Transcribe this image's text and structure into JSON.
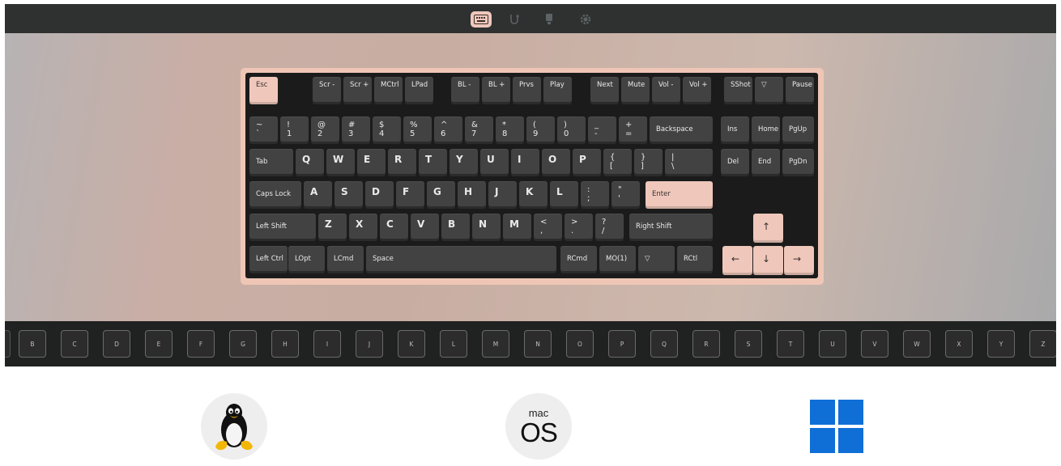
{
  "toolbar": {
    "icons": [
      "keyboard-icon",
      "macro-icon",
      "lighting-icon",
      "settings-icon"
    ],
    "active": "keyboard-icon"
  },
  "keyboard": {
    "row_f": [
      {
        "label": "Esc"
      },
      {
        "label": "Scr -"
      },
      {
        "label": "Scr +"
      },
      {
        "label": "MCtrl"
      },
      {
        "label": "LPad"
      },
      {
        "label": "BL -"
      },
      {
        "label": "BL +"
      },
      {
        "label": "Prvs"
      },
      {
        "label": "Play"
      },
      {
        "label": "Next"
      },
      {
        "label": "Mute"
      },
      {
        "label": "Vol -"
      },
      {
        "label": "Vol +"
      },
      {
        "label": "SShot"
      },
      {
        "label": "▽"
      },
      {
        "label": "Pause"
      }
    ],
    "row_num": [
      {
        "top": "~",
        "bot": "`"
      },
      {
        "top": "!",
        "bot": "1"
      },
      {
        "top": "@",
        "bot": "2"
      },
      {
        "top": "#",
        "bot": "3"
      },
      {
        "top": "$",
        "bot": "4"
      },
      {
        "top": "%",
        "bot": "5"
      },
      {
        "top": "^",
        "bot": "6"
      },
      {
        "top": "&",
        "bot": "7"
      },
      {
        "top": "*",
        "bot": "8"
      },
      {
        "top": "(",
        "bot": "9"
      },
      {
        "top": ")",
        "bot": "0"
      },
      {
        "top": "_",
        "bot": "-"
      },
      {
        "top": "+",
        "bot": "="
      },
      {
        "label": "Backspace"
      },
      {
        "label": "Ins"
      },
      {
        "label": "Home"
      },
      {
        "label": "PgUp"
      }
    ],
    "row_q": [
      {
        "label": "Tab"
      },
      {
        "label": "Q"
      },
      {
        "label": "W"
      },
      {
        "label": "E"
      },
      {
        "label": "R"
      },
      {
        "label": "T"
      },
      {
        "label": "Y"
      },
      {
        "label": "U"
      },
      {
        "label": "I"
      },
      {
        "label": "O"
      },
      {
        "label": "P"
      },
      {
        "top": "{",
        "bot": "["
      },
      {
        "top": "}",
        "bot": "]"
      },
      {
        "top": "|",
        "bot": "\\"
      },
      {
        "label": "Del"
      },
      {
        "label": "End"
      },
      {
        "label": "PgDn"
      }
    ],
    "row_a": [
      {
        "label": "Caps Lock"
      },
      {
        "label": "A"
      },
      {
        "label": "S"
      },
      {
        "label": "D"
      },
      {
        "label": "F"
      },
      {
        "label": "G"
      },
      {
        "label": "H"
      },
      {
        "label": "J"
      },
      {
        "label": "K"
      },
      {
        "label": "L"
      },
      {
        "top": ":",
        "bot": ";"
      },
      {
        "top": "\"",
        "bot": "'"
      },
      {
        "label": "Enter"
      }
    ],
    "row_z": [
      {
        "label": "Left Shift"
      },
      {
        "label": "Z"
      },
      {
        "label": "X"
      },
      {
        "label": "C"
      },
      {
        "label": "V"
      },
      {
        "label": "B"
      },
      {
        "label": "N"
      },
      {
        "label": "M"
      },
      {
        "top": "<",
        "bot": ","
      },
      {
        "top": ">",
        "bot": "."
      },
      {
        "top": "?",
        "bot": "/"
      },
      {
        "label": "Right Shift"
      },
      {
        "label": "↑"
      }
    ],
    "row_b": [
      {
        "label": "Left Ctrl"
      },
      {
        "label": "LOpt"
      },
      {
        "label": "LCmd"
      },
      {
        "label": "Space"
      },
      {
        "label": "RCmd"
      },
      {
        "label": "MO(1)"
      },
      {
        "label": "▽"
      },
      {
        "label": "RCtl"
      },
      {
        "label": "←"
      },
      {
        "label": "↓"
      },
      {
        "label": "→"
      }
    ]
  },
  "key_strip": [
    "B",
    "C",
    "D",
    "E",
    "F",
    "G",
    "H",
    "I",
    "J",
    "K",
    "L",
    "M",
    "N",
    "O",
    "P",
    "Q",
    "R",
    "S",
    "T",
    "U",
    "V",
    "W",
    "X",
    "Y",
    "Z"
  ],
  "os": {
    "linux": "linux-tux-icon",
    "mac_small": "mac",
    "mac_large": "OS",
    "windows": "windows-logo-icon"
  },
  "colors": {
    "accent": "#efc8bb",
    "toolbar": "#2f3131",
    "keycap": "#424242",
    "windows_blue": "#0f6fd6"
  }
}
